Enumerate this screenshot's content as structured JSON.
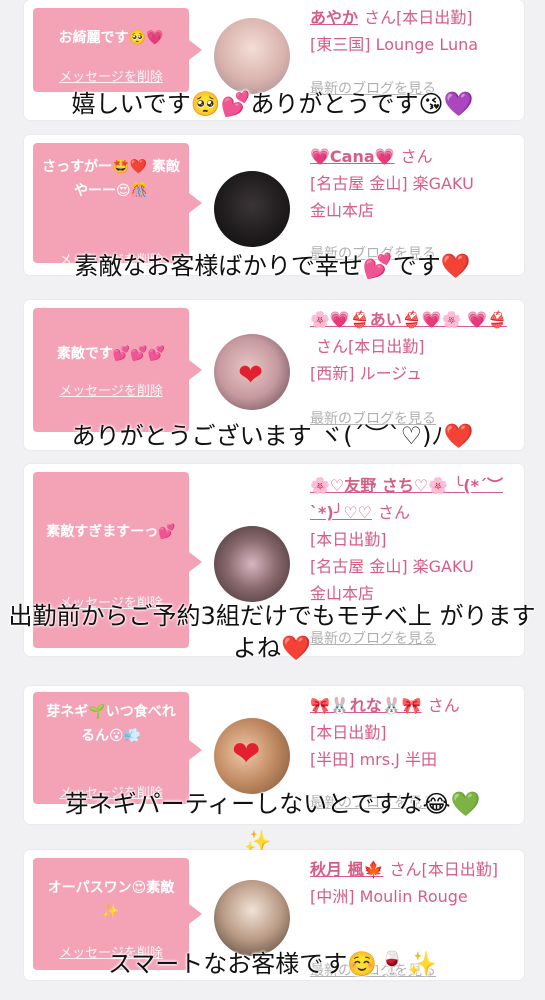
{
  "cards": [
    {
      "message": "お綺麗です🥺💗",
      "delete_label": "メッセージを削除",
      "name": "あやか",
      "san": "さん",
      "details": [
        "[本日出勤]",
        "[東三国] Lounge Luna"
      ],
      "blog_label": "最新のブログを見る",
      "overlay": "嬉しいです🥺💕ありがとうです😘💜"
    },
    {
      "message": "さっすがー🤩❤️ 素敵やーー😍🎊",
      "delete_label": "メッセージを削除",
      "name": "💗Cana💗",
      "san": "さん",
      "details": [
        "[名古屋 金山] 楽GAKU",
        "金山本店"
      ],
      "blog_label": "最新のブログを見る",
      "overlay": "素敵なお客様ばかりで幸せ💕です❤️"
    },
    {
      "message": "素敵です💕💕💕",
      "delete_label": "メッセージを削除",
      "name": "🌸💗👙あい👙💗🌸 💗👙",
      "san": "さん[本日出勤]",
      "details": [
        "[西新] ルージュ"
      ],
      "blog_label": "最新のブログを見る",
      "overlay": "ありがとうございます ヾ(´︶`♡)ﾉ❤️"
    },
    {
      "message": "素敵すぎますーっ💕",
      "delete_label": "メッセージを削除",
      "name": "🌸♡友野 さち♡🌸 ╰(*´︶`*)╯♡♡",
      "san": "さん",
      "details": [
        "[本日出勤]",
        "[名古屋 金山] 楽GAKU",
        "金山本店"
      ],
      "blog_label": "最新のブログを見る",
      "overlay": "出勤前からご予約3組だけでもモチベ上 がりますよね❤️"
    },
    {
      "message": "芽ネギ🌱いつ食べれるん😮💨",
      "delete_label": "メッセージを削除",
      "name": "🎀🐰れな🐰🎀",
      "san": "さん",
      "details": [
        "[本日出勤]",
        "[半田] mrs.J 半田"
      ],
      "blog_label": "最新のブログを見る",
      "overlay": "芽ネギパーティーしないとですな😂💚"
    },
    {
      "message": "オーパスワン😍素敵✨",
      "delete_label": "メッセージを削除",
      "name": "秋月 楓🍁",
      "san": "さん[本日出勤]",
      "details": [
        "[中洲] Moulin Rouge"
      ],
      "blog_label": "最新のブログを見る",
      "overlay": "スマートなお客様です☺️🍷✨"
    }
  ],
  "colors": {
    "bubble": "#f4a3b7",
    "name": "#d65d84",
    "background": "#f1f1f3"
  },
  "icons": [
    "sparkle-icon"
  ]
}
